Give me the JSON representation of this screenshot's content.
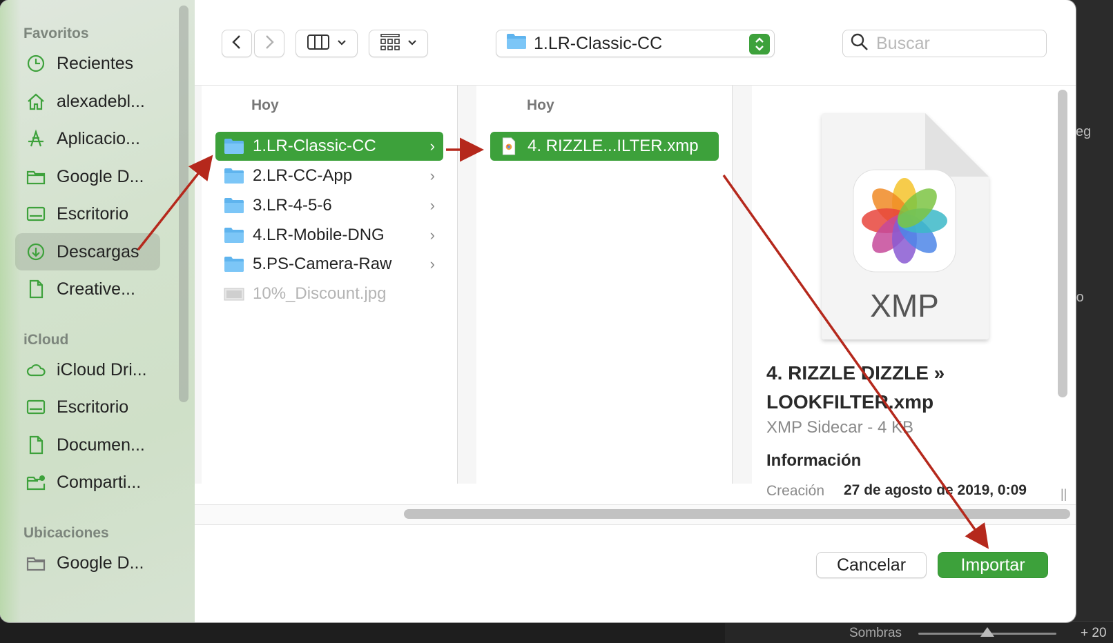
{
  "sidebar": {
    "favorites_heading": "Favoritos",
    "favorites": [
      {
        "label": "Recientes",
        "icon": "clock-icon"
      },
      {
        "label": "alexadebl...",
        "icon": "home-icon"
      },
      {
        "label": "Aplicacio...",
        "icon": "applications-icon"
      },
      {
        "label": "Google D...",
        "icon": "folder-icon"
      },
      {
        "label": "Escritorio",
        "icon": "desktop-icon"
      },
      {
        "label": "Descargas",
        "icon": "downloads-icon",
        "selected": true
      },
      {
        "label": "Creative...",
        "icon": "document-icon"
      }
    ],
    "icloud_heading": "iCloud",
    "icloud": [
      {
        "label": "iCloud Dri...",
        "icon": "cloud-icon"
      },
      {
        "label": "Escritorio",
        "icon": "desktop-icon"
      },
      {
        "label": "Documen...",
        "icon": "document-icon"
      },
      {
        "label": "Comparti...",
        "icon": "shared-folder-icon"
      }
    ],
    "locations_heading": "Ubicaciones",
    "locations": [
      {
        "label": "Google D...",
        "icon": "folder-icon"
      }
    ]
  },
  "toolbar": {
    "path_label": "1.LR-Classic-CC",
    "search_placeholder": "Buscar"
  },
  "columns": [
    {
      "heading": "Hoy",
      "items": [
        {
          "label": "1.LR-Classic-CC",
          "type": "folder",
          "selected": true
        },
        {
          "label": "2.LR-CC-App",
          "type": "folder"
        },
        {
          "label": "3.LR-4-5-6",
          "type": "folder"
        },
        {
          "label": "4.LR-Mobile-DNG",
          "type": "folder"
        },
        {
          "label": "5.PS-Camera-Raw",
          "type": "folder"
        },
        {
          "label": "10%_Discount.jpg",
          "type": "image",
          "disabled": true
        }
      ]
    },
    {
      "heading": "Hoy",
      "items": [
        {
          "label": "4. RIZZLE...ILTER.xmp",
          "type": "xmp",
          "selected": true
        }
      ]
    }
  ],
  "preview": {
    "file_badge": "XMP",
    "title": "4. RIZZLE DIZZLE » LOOKFILTER.xmp",
    "kind": "XMP Sidecar - 4 KB",
    "info_heading": "Información",
    "created_label": "Creación",
    "created_value": "27 de agosto de 2019, 0:09"
  },
  "buttons": {
    "cancel": "Cancelar",
    "import": "Importar"
  },
  "background_app": {
    "slider_label": "Sombras",
    "slider_value": "+ 20"
  },
  "colors": {
    "accent": "#3da13b",
    "annotation_arrow": "#b5281c"
  }
}
